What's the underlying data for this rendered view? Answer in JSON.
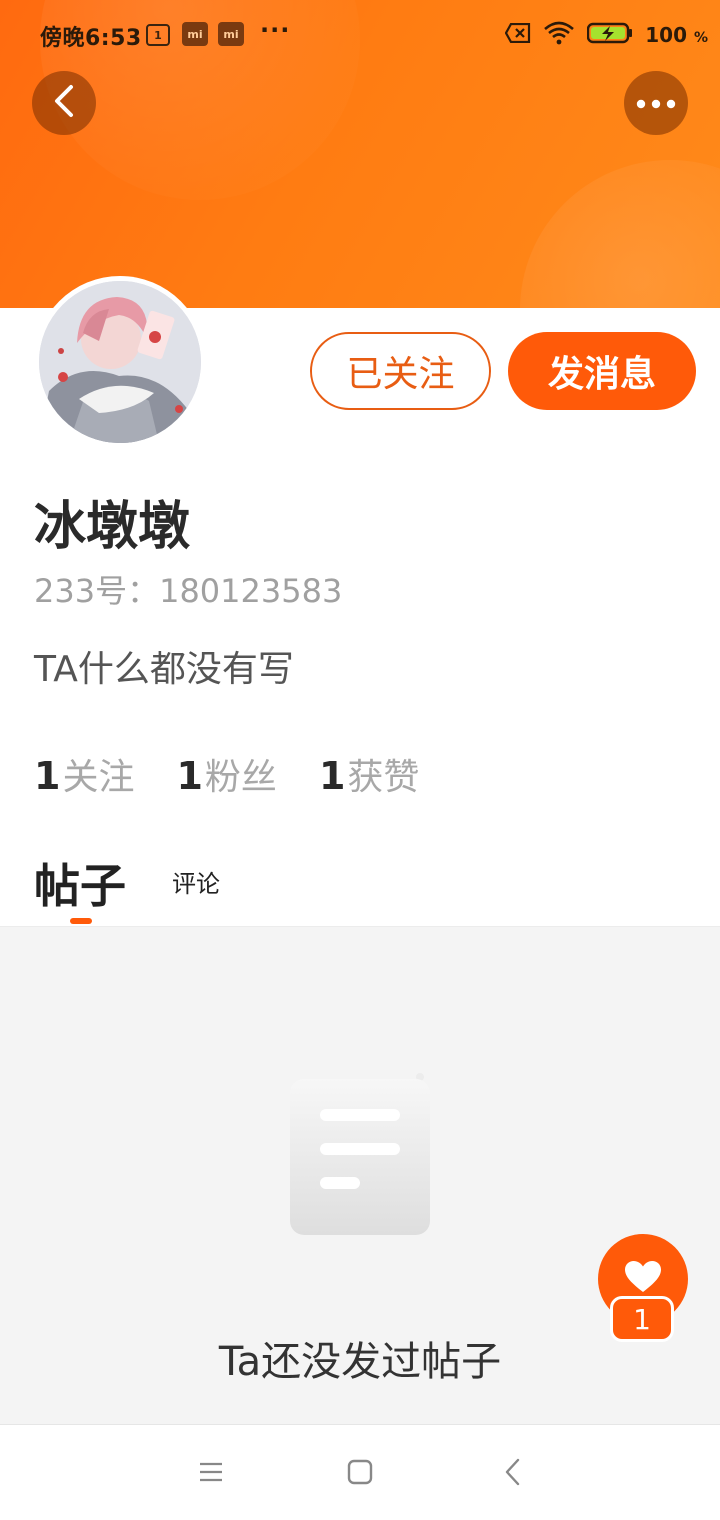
{
  "status_bar": {
    "time": "傍晚6:53",
    "calendar_day": "1",
    "app_icon_label": "mi",
    "overflow": "···",
    "battery_level": "100",
    "battery_unit": "%"
  },
  "profile": {
    "follow_label": "已关注",
    "message_label": "发消息",
    "username": "冰墩墩",
    "user_id": "233号：180123583",
    "bio": "TA什么都没有写"
  },
  "stats": [
    {
      "count": "1",
      "label": "关注"
    },
    {
      "count": "1",
      "label": "粉丝"
    },
    {
      "count": "1",
      "label": "获赞"
    }
  ],
  "tabs": {
    "posts": "帖子",
    "comments": "评论"
  },
  "empty_state": {
    "message": "Ta还没发过帖子"
  },
  "like": {
    "count": "1"
  },
  "colors": {
    "accent": "#ff5a09",
    "banner": "#ff7c12"
  }
}
